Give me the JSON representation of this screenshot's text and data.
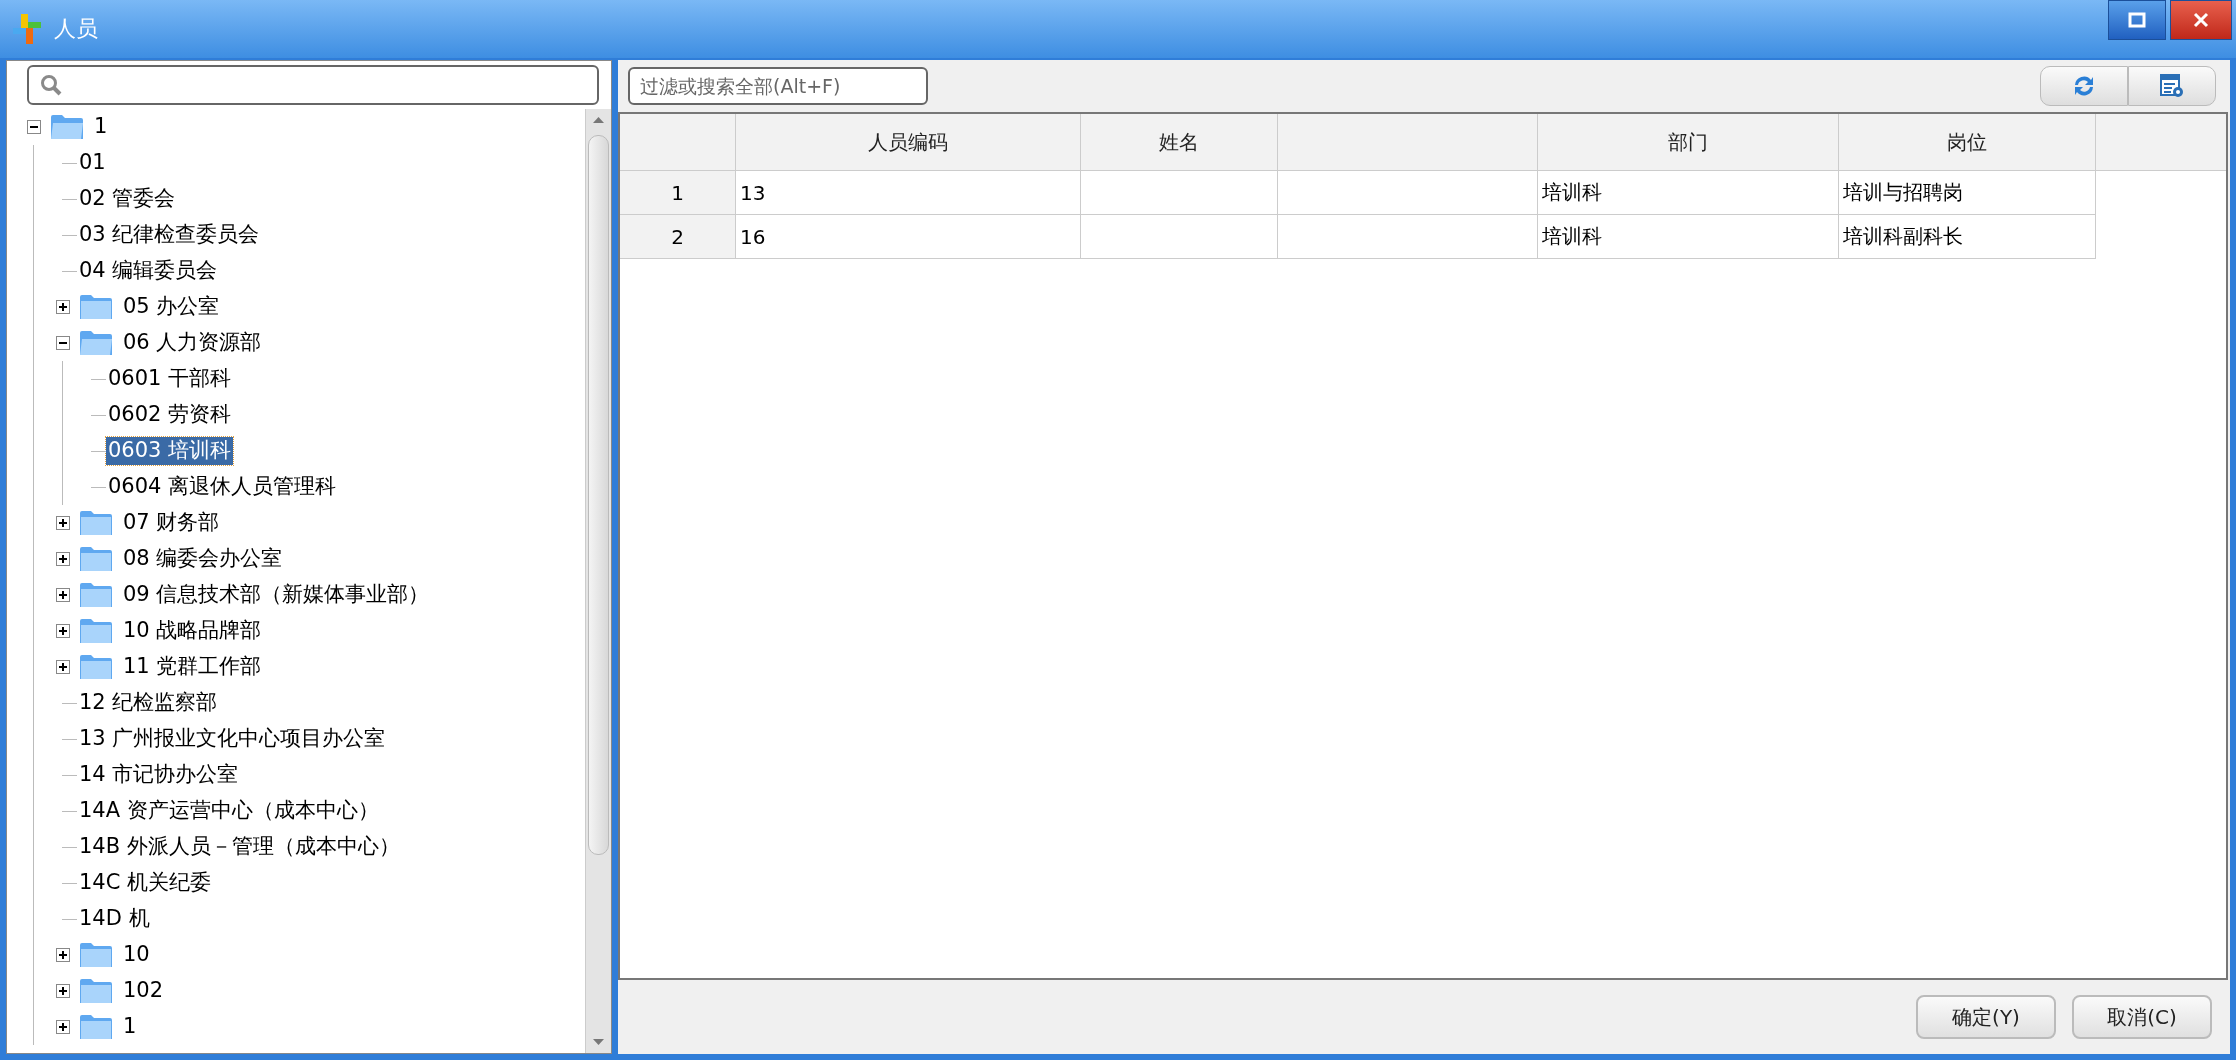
{
  "window": {
    "title": "人员"
  },
  "sidebar": {
    "tree": [
      {
        "label": "1",
        "kind": "folder",
        "expanded": true,
        "selected": false,
        "children": [
          {
            "label": "01",
            "kind": "leaf",
            "selected": false
          },
          {
            "label": "02 管委会",
            "kind": "leaf",
            "selected": false
          },
          {
            "label": "03 纪律检查委员会",
            "kind": "leaf",
            "selected": false
          },
          {
            "label": "04 编辑委员会",
            "kind": "leaf",
            "selected": false
          },
          {
            "label": "05 办公室",
            "kind": "folder",
            "expanded": false,
            "selected": false
          },
          {
            "label": "06 人力资源部",
            "kind": "folder",
            "expanded": true,
            "selected": false,
            "children": [
              {
                "label": "0601 干部科",
                "kind": "leaf",
                "selected": false
              },
              {
                "label": "0602 劳资科",
                "kind": "leaf",
                "selected": false
              },
              {
                "label": "0603 培训科",
                "kind": "leaf",
                "selected": true
              },
              {
                "label": "0604 离退休人员管理科",
                "kind": "leaf",
                "selected": false
              }
            ]
          },
          {
            "label": "07 财务部",
            "kind": "folder",
            "expanded": false,
            "selected": false
          },
          {
            "label": "08 编委会办公室",
            "kind": "folder",
            "expanded": false,
            "selected": false
          },
          {
            "label": "09 信息技术部（新媒体事业部）",
            "kind": "folder",
            "expanded": false,
            "selected": false
          },
          {
            "label": "10 战略品牌部",
            "kind": "folder",
            "expanded": false,
            "selected": false
          },
          {
            "label": "11 党群工作部",
            "kind": "folder",
            "expanded": false,
            "selected": false
          },
          {
            "label": "12 纪检监察部",
            "kind": "leaf",
            "selected": false
          },
          {
            "label": "13 广州报业文化中心项目办公室",
            "kind": "leaf",
            "selected": false
          },
          {
            "label": "14 市记协办公室",
            "kind": "leaf",
            "selected": false
          },
          {
            "label": "14A 资产运营中心（成本中心）",
            "kind": "leaf",
            "selected": false
          },
          {
            "label": "14B 外派人员－管理（成本中心）",
            "kind": "leaf",
            "selected": false
          },
          {
            "label": "14C 机关纪委",
            "kind": "leaf",
            "selected": false
          },
          {
            "label": "14D 机",
            "kind": "leaf",
            "selected": false
          },
          {
            "label": "10",
            "kind": "folder",
            "expanded": false,
            "selected": false
          },
          {
            "label": "102",
            "kind": "folder",
            "expanded": false,
            "selected": false
          },
          {
            "label": "1",
            "kind": "folder",
            "expanded": false,
            "selected": false
          }
        ]
      }
    ]
  },
  "filter": {
    "placeholder": "过滤或搜索全部(Alt+F)"
  },
  "table": {
    "columns": [
      {
        "label": "人员编码"
      },
      {
        "label": "姓名"
      },
      {},
      {
        "label": "部门"
      },
      {
        "label": "岗位"
      }
    ],
    "rows": [
      {
        "number": "1",
        "cells": [
          "13",
          null,
          null,
          "培训科",
          "培训与招聘岗"
        ]
      },
      {
        "number": "2",
        "cells": [
          "16",
          null,
          null,
          "培训科",
          "培训科副科长"
        ]
      }
    ]
  },
  "buttons": [
    "确定(Y)",
    "取消(C)"
  ]
}
